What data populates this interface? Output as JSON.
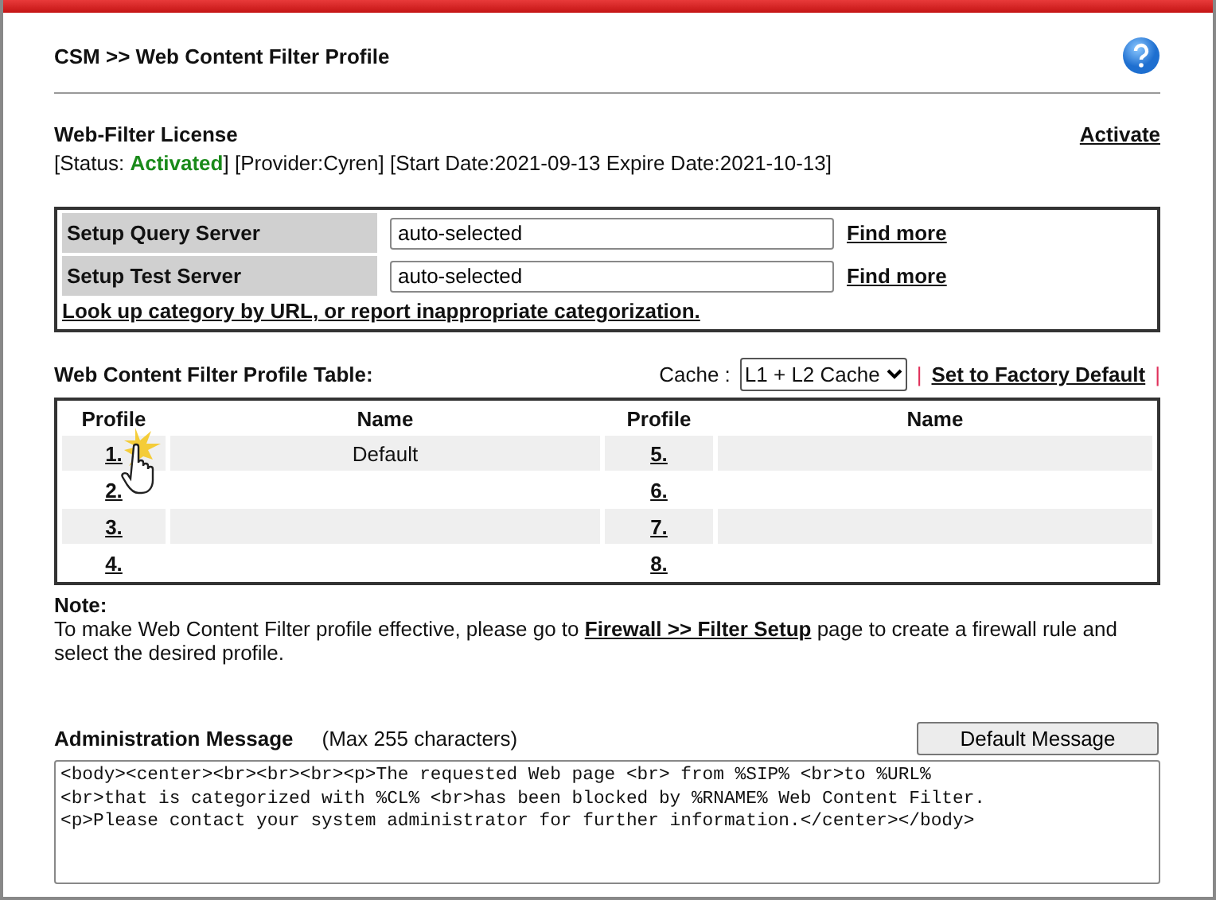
{
  "page_title": "CSM >> Web Content Filter Profile",
  "license": {
    "title": "Web-Filter License",
    "activate_link": "Activate",
    "status_prefix": "[Status: ",
    "status": "Activated",
    "status_suffix": "] [Provider:Cyren] [Start Date:2021-09-13 Expire Date:2021-10-13]"
  },
  "servers": [
    {
      "label": "Setup Query Server",
      "value": "auto-selected",
      "link": "Find more"
    },
    {
      "label": "Setup Test Server",
      "value": "auto-selected",
      "link": "Find more"
    }
  ],
  "lookup_link": "Look up category by URL, or report inappropriate categorization.",
  "profile_table": {
    "title": "Web Content Filter Profile Table:",
    "cache_label": "Cache :",
    "cache_value": "L1 + L2 Cache",
    "factory_link": "Set to Factory Default",
    "separator": "|",
    "columns": [
      "Profile",
      "Name",
      "Profile",
      "Name"
    ],
    "rows": [
      {
        "left_profile": "1.",
        "left_name": "Default",
        "right_profile": "5."
      },
      {
        "left_profile": "2.",
        "right_profile": "6."
      },
      {
        "left_profile": "3.",
        "right_profile": "7."
      },
      {
        "left_profile": "4.",
        "right_profile": "8."
      }
    ]
  },
  "note": {
    "title": "Note:",
    "text_before": "To make Web Content Filter profile effective, please go to ",
    "link": "Firewall >> Filter Setup",
    "text_after": " page to create a firewall rule and select the desired profile."
  },
  "admin_message": {
    "title": "Administration Message",
    "hint": "(Max 255 characters)",
    "button": "Default Message",
    "lines": [
      "<body><center><br><br><br><p>The requested Web page <br> from %SIP% <br>to %URL%",
      "<br>that is categorized with %CL% <br>has been blocked by %RNAME% Web Content Filter.",
      "<p>Please contact your system administrator for further information.</center></body>"
    ]
  }
}
